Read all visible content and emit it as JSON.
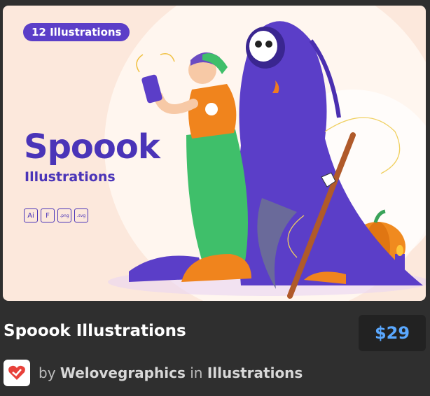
{
  "preview": {
    "badge": "12 Illustrations",
    "title": "Spoook",
    "subtitle": "Illustrations",
    "formats": [
      "Ai",
      "F",
      ".png",
      ".svg"
    ]
  },
  "product": {
    "title": "Spoook Illustrations",
    "price": "$29",
    "by_label": "by",
    "author": "Welovegraphics",
    "in_label": "in",
    "category": "Illustrations"
  },
  "colors": {
    "background": "#2f2f2f",
    "preview_bg": "#fce8dc",
    "brand_purple": "#4a34b8",
    "price_blue": "#5aa8ff",
    "logo_red": "#e8413a"
  }
}
